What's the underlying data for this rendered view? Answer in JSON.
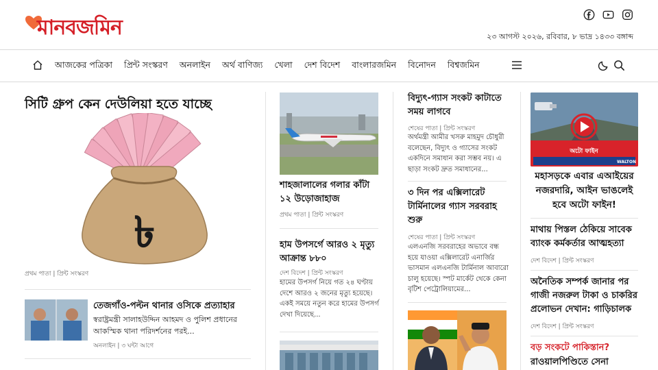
{
  "site": {
    "logo_text": "মানবজমিন",
    "date_line": "২৩ আগস্ট ২০২৬, রবিবার, ৮ ভাদ্র ১৪৩৩ বঙ্গাব্দ",
    "brand_color": "#d51f27",
    "social_icons": [
      "facebook-icon",
      "youtube-icon",
      "instagram-icon"
    ]
  },
  "nav": {
    "items": [
      {
        "label": "আজকের পত্রিকা"
      },
      {
        "label": "প্রিন্ট সংস্করণ"
      },
      {
        "label": "অনলাইন"
      },
      {
        "label": "অর্থ বাণিজ্য"
      },
      {
        "label": "খেলা"
      },
      {
        "label": "দেশ বিদেশ"
      },
      {
        "label": "বাংলারজমিন"
      },
      {
        "label": "বিনোদন"
      },
      {
        "label": "বিশ্বজমিন"
      }
    ]
  },
  "lead": {
    "title": "সিটি গ্রুপ কেন দেউলিয়া হতে যাচ্ছে",
    "tag": "প্রথম পাতা | প্রিন্ট সংস্করণ"
  },
  "story2": {
    "title": "তেজগাঁও-পল্টন থানার ওসিকে প্রত্যাহার",
    "summary": "স্বরাষ্ট্রমন্ত্রী সালাহউদ্দিন আহমদ ও পুলিশ প্রধানের আকস্মিক থানা পরিদর্শনের পরই...",
    "tag": "অনলাইন | ৩ ঘন্টা আগে"
  },
  "col2": {
    "story1": {
      "title": "শাহজালালের গলার কাঁটা ১২ উড়োজাহাজ",
      "tag": "প্রথম পাতা | প্রিন্ট সংস্করণ"
    },
    "story2": {
      "title": "হাম উপসর্গে আরও ২ মৃত্যু আক্রান্ত ৮৮০",
      "tag": "দেশ বিদেশ | প্রিন্ট সংস্করণ",
      "summary": "হামের উপসর্গ নিয়ে গত ২৪ ঘণ্টায় দেশে আরও ২ জনের মৃত্যু হয়েছে। একই সময়ে নতুন করে হামের উপসর্গ দেখা দিয়েছে..."
    }
  },
  "col3": {
    "story1": {
      "title": "বিদ্যুৎ-গ্যাস সংকট কাটাতে সময় লাগবে",
      "tag": "শেষের পাতা | প্রিন্ট সংস্করণ",
      "summary": "অর্থমন্ত্রী আমীর খসরু মাহমুদ চৌধুরী বলেছেন, বিদ্যুৎ ও গ্যাসের সংকট একদিনে সমাধান করা সম্ভব নয়। এ ছাড়া সংকট দ্রুত সমাধানের..."
    },
    "story2": {
      "title": "৩ দিন পর এক্সিলারেট টার্মিনালের গ্যাস সরবরাহ শুরু",
      "tag": "শেষের পাতা | প্রিন্ট সংস্করণ",
      "summary": "এলএনজি সরবরাহের অভাবে বন্ধ হয়ে যাওয়া এক্সিলারেট এনার্জির ভাসমান এলএনজি টার্মিনাল আবারো চালু হয়েছে। স্পট মার্কেট থেকে কেনা বৃটিশ পেট্রোলিয়ামের..."
    }
  },
  "col4": {
    "video": {
      "title": "মহাসড়কে এবার এআইয়ের নজরদারি, আইন ভাঙলেই হবে অটো ফাইন!",
      "overlay_text": "অটো ফাইন",
      "brand": "WALTON"
    },
    "story1": {
      "title": "মাথায় পিস্তল ঠেকিয়ে সাবেক ব্যাংক কর্মকর্তার আত্মহত্যা",
      "tag": "দেশ বিদেশ | প্রিন্ট সংস্করণ"
    },
    "story2": {
      "title": "অনৈতিক সম্পর্ক জানার পর গাজী নজরুল টাকা ও চাকরির প্রলোভন দেখান: গাড়িচালক",
      "tag": "দেশ বিদেশ | প্রিন্ট সংস্করণ"
    },
    "story3": {
      "kicker": "বড় সংকটে পাকিস্তান?",
      "title": "রাওয়ালপিণ্ডিতে সেনা"
    }
  }
}
